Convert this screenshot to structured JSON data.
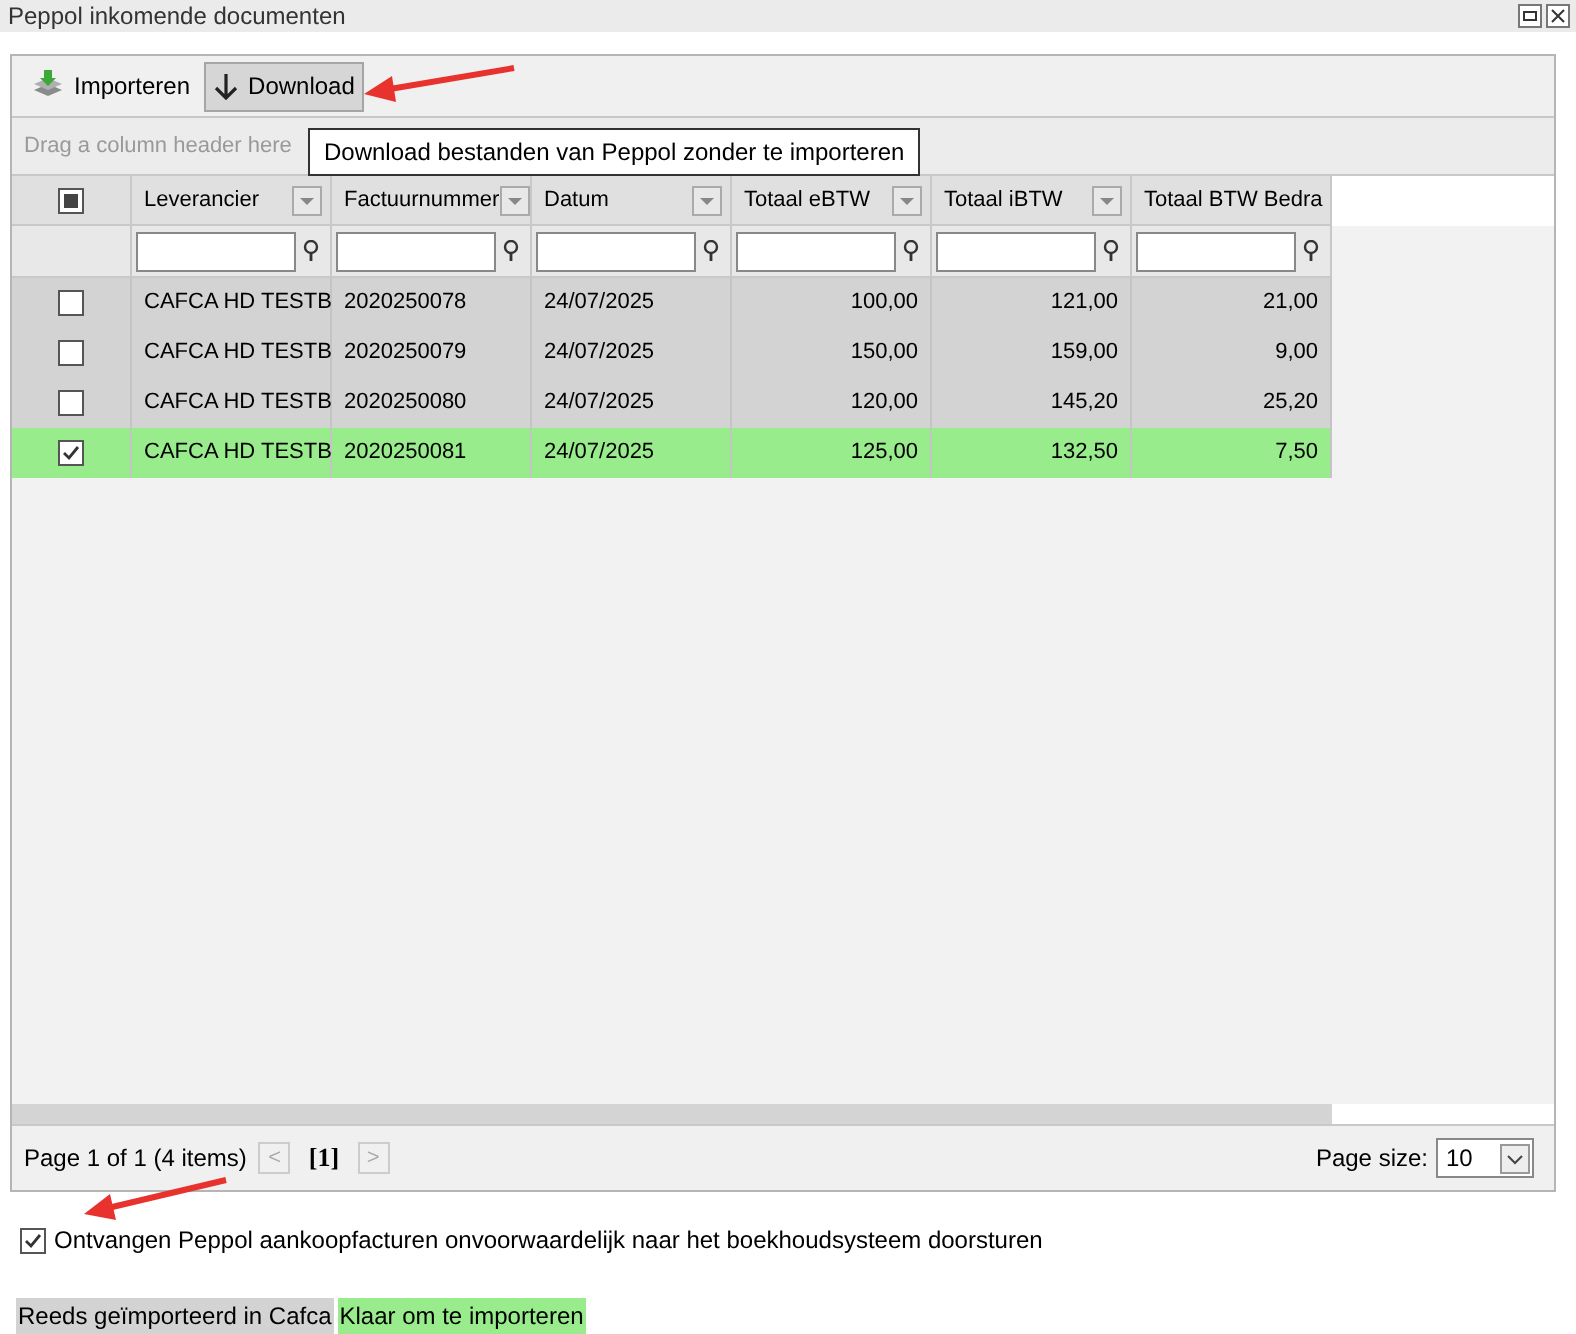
{
  "window": {
    "title": "Peppol inkomende documenten"
  },
  "toolbar": [
    {
      "label": "Importeren",
      "kind": "import",
      "pressed": false
    },
    {
      "label": "Download",
      "kind": "download",
      "pressed": true
    }
  ],
  "tooltip": "Download bestanden van Peppol zonder te importeren",
  "group_panel": "Drag a column header here",
  "table": {
    "select_all": {
      "checked": false,
      "indeterminate": true
    },
    "columns": [
      {
        "label": "Leverancier",
        "kind": "text"
      },
      {
        "label": "Factuurnummer",
        "kind": "text"
      },
      {
        "label": "Datum",
        "kind": "text"
      },
      {
        "label": "Totaal eBTW",
        "kind": "amount"
      },
      {
        "label": "Totaal iBTW",
        "kind": "amount"
      },
      {
        "label": "Totaal BTW Bedra",
        "kind": "amount"
      }
    ],
    "rows": [
      {
        "checked": false,
        "color": "#d3d3d3",
        "cells": [
          "CAFCA HD TESTB",
          "2020250078",
          "24/07/2025",
          "100,00",
          "121,00",
          "21,00"
        ]
      },
      {
        "checked": false,
        "color": "#d3d3d3",
        "cells": [
          "CAFCA HD TESTB",
          "2020250079",
          "24/07/2025",
          "150,00",
          "159,00",
          "9,00"
        ]
      },
      {
        "checked": false,
        "color": "#d3d3d3",
        "cells": [
          "CAFCA HD TESTB",
          "2020250080",
          "24/07/2025",
          "120,00",
          "145,20",
          "25,20"
        ]
      },
      {
        "checked": true,
        "color": "#98ec8c",
        "cells": [
          "CAFCA HD TESTB",
          "2020250081",
          "24/07/2025",
          "125,00",
          "132,50",
          "7,50"
        ]
      }
    ]
  },
  "pager": {
    "info": "Page 1 of 1 (4 items)",
    "prev": "<",
    "current": "[1]",
    "next": ">",
    "page_size_label": "Page size:",
    "page_size": "10"
  },
  "forward_option": {
    "label": "Ontvangen Peppol aankoopfacturen onvoorwaardelijk naar het boekhoudsysteem doorsturen",
    "checked": true
  },
  "legend": [
    {
      "label": "Reeds geïmporteerd in Cafca",
      "color": "#d3d3d3"
    },
    {
      "label": "Klaar om te importeren",
      "color": "#98ec8c"
    }
  ]
}
